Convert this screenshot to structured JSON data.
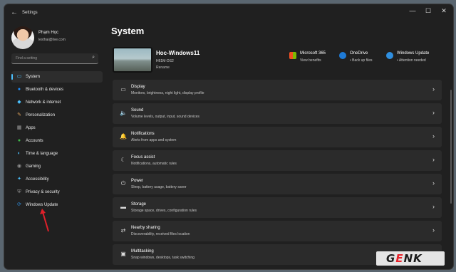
{
  "app": {
    "title": "Settings",
    "back_icon": "←"
  },
  "window_controls": {
    "minimize": "—",
    "maximize": "☐",
    "close": "✕"
  },
  "profile": {
    "name": "Phạm Học",
    "email": "lexthai@live.com"
  },
  "search": {
    "placeholder": "Find a setting",
    "icon": "⌕"
  },
  "nav": {
    "items": [
      {
        "label": "System",
        "icon": "▭",
        "color": "#4cc2ff",
        "active": true
      },
      {
        "label": "Bluetooth & devices",
        "icon": "●",
        "color": "#1e90ff"
      },
      {
        "label": "Network & internet",
        "icon": "◆",
        "color": "#4cc2ff"
      },
      {
        "label": "Personalization",
        "icon": "✎",
        "color": "#e0a45c"
      },
      {
        "label": "Apps",
        "icon": "▦",
        "color": "#9a9a9a"
      },
      {
        "label": "Accounts",
        "icon": "●",
        "color": "#3fb94a"
      },
      {
        "label": "Time & language",
        "icon": "◐",
        "color": "#4cc2ff"
      },
      {
        "label": "Gaming",
        "icon": "◉",
        "color": "#8f8f8f"
      },
      {
        "label": "Accessibility",
        "icon": "✦",
        "color": "#4cc2ff"
      },
      {
        "label": "Privacy & security",
        "icon": "⛨",
        "color": "#9a9a9a"
      },
      {
        "label": "Windows Update",
        "icon": "⟳",
        "color": "#2f8fe0"
      }
    ]
  },
  "page": {
    "title": "System"
  },
  "device": {
    "name": "Hoc-Windows11",
    "model": "H61M-DS2",
    "rename": "Rename"
  },
  "status": [
    {
      "title": "Microsoft 365",
      "sub": "View benefits",
      "icon": "ms365-icon"
    },
    {
      "title": "OneDrive",
      "sub": "• Back up files",
      "icon": "onedrive-icon"
    },
    {
      "title": "Windows Update",
      "sub": "• Attention needed",
      "icon": "windows-update-icon"
    }
  ],
  "cards": [
    {
      "title": "Display",
      "sub": "Monitors, brightness, night light, display profile",
      "icon": "▭"
    },
    {
      "title": "Sound",
      "sub": "Volume levels, output, input, sound devices",
      "icon": "🔈"
    },
    {
      "title": "Notifications",
      "sub": "Alerts from apps and system",
      "icon": "🔔"
    },
    {
      "title": "Focus assist",
      "sub": "Notifications, automatic rules",
      "icon": "☾"
    },
    {
      "title": "Power",
      "sub": "Sleep, battery usage, battery saver",
      "icon": "⏻"
    },
    {
      "title": "Storage",
      "sub": "Storage space, drives, configuration rules",
      "icon": "▬"
    },
    {
      "title": "Nearby sharing",
      "sub": "Discoverability, received files location",
      "icon": "⇄"
    },
    {
      "title": "Multitasking",
      "sub": "Snap windows, desktops, task switching",
      "icon": "▣"
    }
  ],
  "chevron": "›",
  "watermark": {
    "g": "G",
    "e": "E",
    "nk": "NK"
  },
  "colors": {
    "accent": "#4cc2ff",
    "window_bg": "#202020",
    "card_bg": "#2b2b2b",
    "annotation_arrow": "#e0202a"
  }
}
